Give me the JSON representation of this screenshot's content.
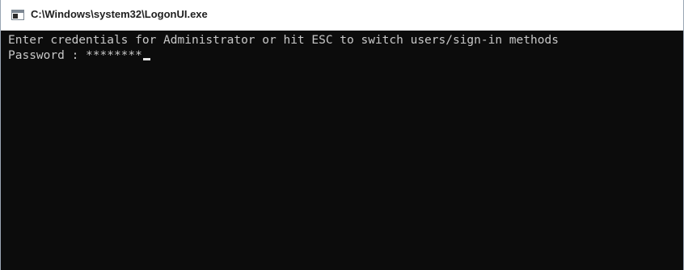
{
  "window": {
    "title": "C:\\Windows\\system32\\LogonUI.exe",
    "icon": "console-window-icon"
  },
  "console": {
    "prompt_line": "Enter credentials for Administrator or hit ESC to switch users/sign-in methods",
    "password_label": "Password : ",
    "password_value": "********",
    "background_color": "#0c0c0c",
    "text_color": "#c8c8c8"
  }
}
